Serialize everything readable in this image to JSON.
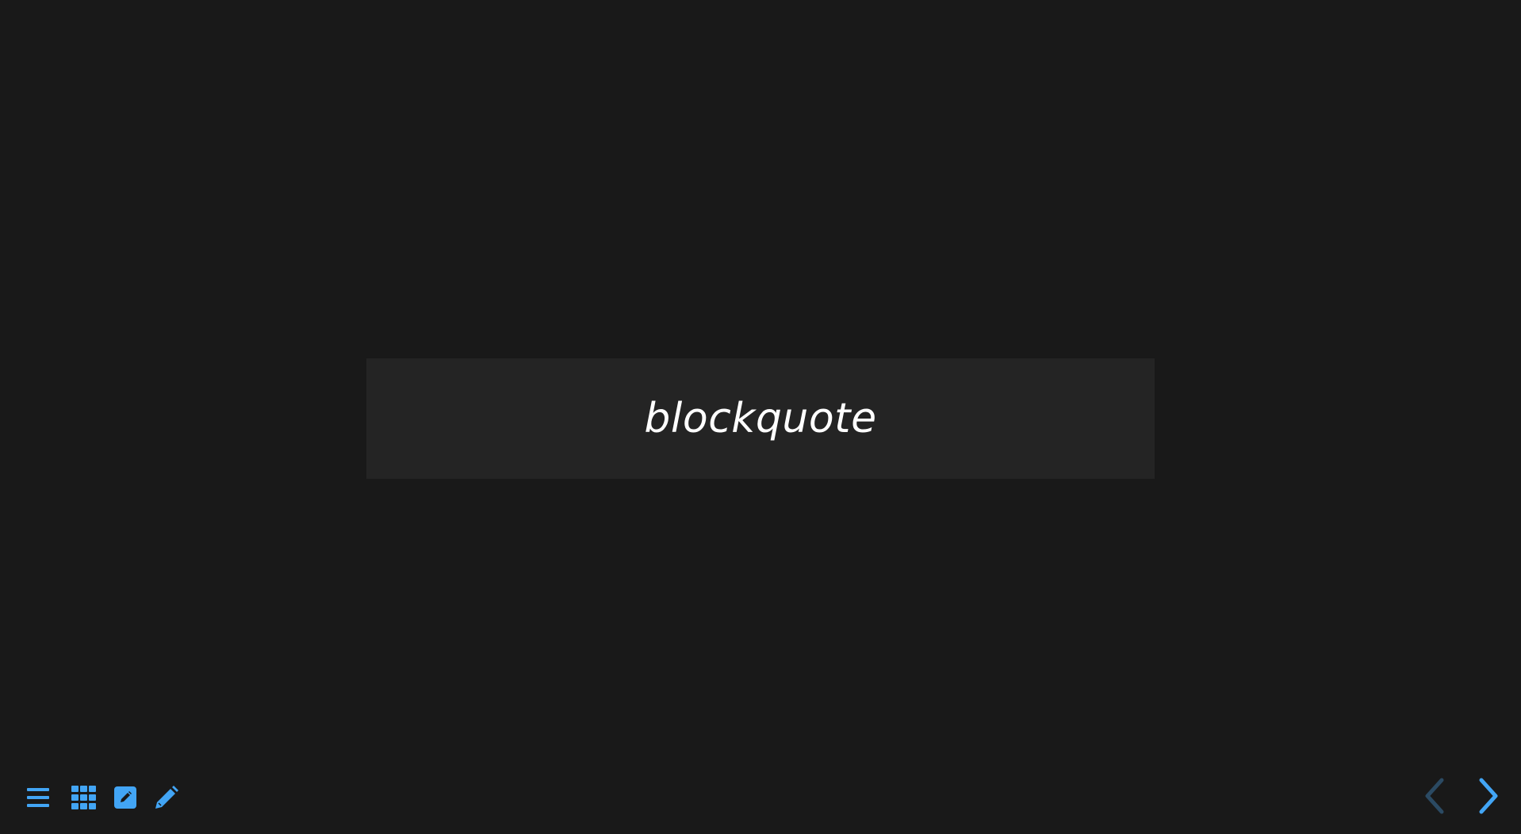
{
  "slide": {
    "blockquote_text": "blockquote"
  },
  "toolbar": {
    "items": [
      {
        "name": "menu",
        "icon": "menu-icon"
      },
      {
        "name": "overview",
        "icon": "grid-icon"
      },
      {
        "name": "notes",
        "icon": "edit-note-icon"
      },
      {
        "name": "draw",
        "icon": "pencil-icon"
      }
    ]
  },
  "navigation": {
    "prev": {
      "icon": "chevron-left-icon",
      "enabled": false
    },
    "next": {
      "icon": "chevron-right-icon",
      "enabled": true
    }
  },
  "colors": {
    "background": "#191919",
    "blockquote_bg": "#242424",
    "accent": "#42A5F5",
    "accent_disabled": "#2B4A63",
    "text": "#FFFFFF"
  }
}
